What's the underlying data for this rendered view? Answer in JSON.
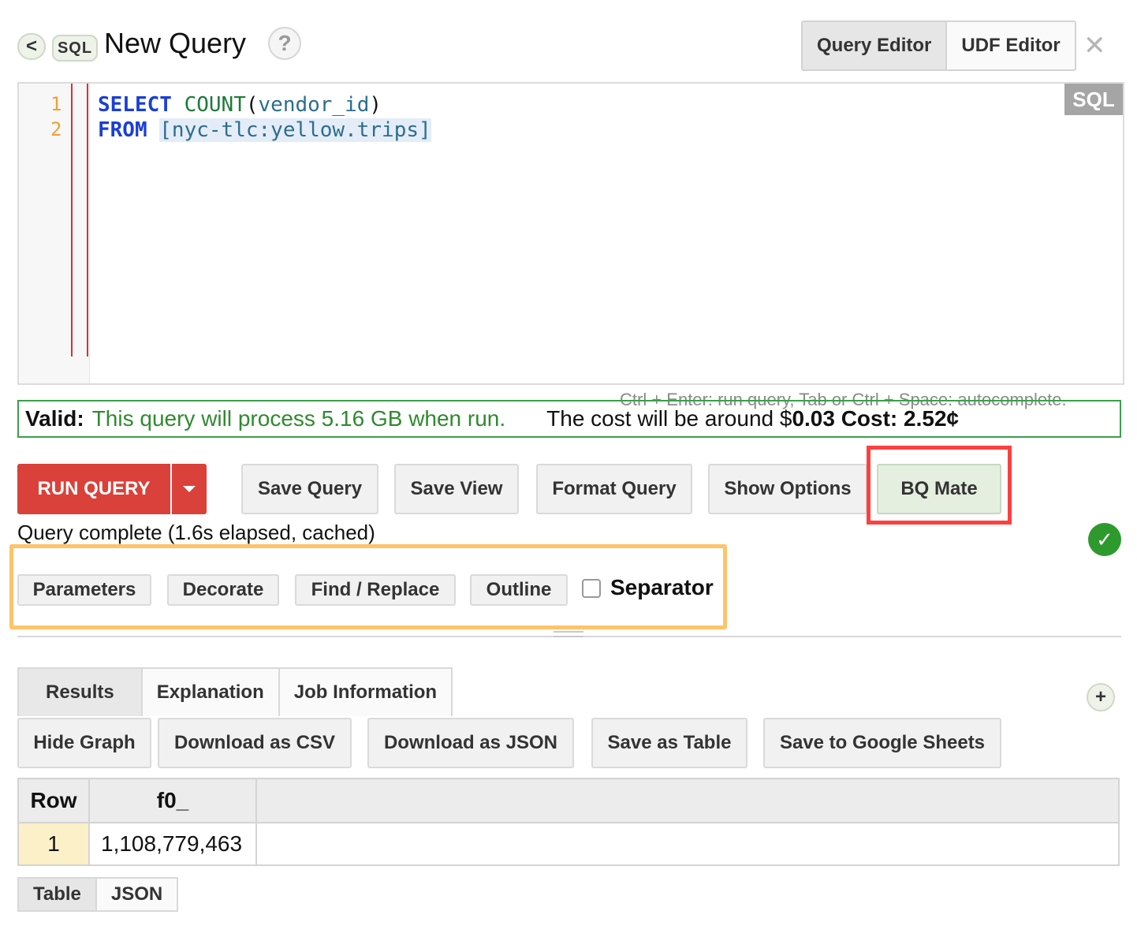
{
  "header": {
    "back_label": "<",
    "sql_badge": "SQL",
    "title": "New Query",
    "help_label": "?",
    "tabs": [
      {
        "label": "Query Editor",
        "active": true
      },
      {
        "label": "UDF Editor",
        "active": false
      }
    ],
    "close_label": "✕"
  },
  "editor": {
    "language_tag": "SQL",
    "line_numbers": [
      "1",
      "2"
    ],
    "lines": [
      {
        "keyword": "SELECT",
        "function": "COUNT",
        "open": "(",
        "arg": "vendor_id",
        "close": ")"
      },
      {
        "keyword": "FROM",
        "table": "[nyc-tlc:yellow.trips]"
      }
    ],
    "hint": "Ctrl + Enter: run query, Tab or Ctrl + Space: autocomplete."
  },
  "validation": {
    "label": "Valid:",
    "message": "This query will process 5.16 GB when run.",
    "cost_prefix": "The cost will be around $",
    "cost_value": "0.03 Cost: 2.52¢"
  },
  "actions": {
    "run_label": "RUN QUERY",
    "buttons": [
      "Save Query",
      "Save View",
      "Format Query",
      "Show Options",
      "BQ Mate"
    ]
  },
  "status": {
    "text": "Query complete (1.6s elapsed, cached)",
    "check": "✓"
  },
  "tools": {
    "buttons": [
      "Parameters",
      "Decorate",
      "Find / Replace",
      "Outline"
    ],
    "separator_label": "Separator"
  },
  "results": {
    "tabs": [
      {
        "label": "Results",
        "active": true
      },
      {
        "label": "Explanation",
        "active": false
      },
      {
        "label": "Job Information",
        "active": false
      }
    ],
    "plus_label": "+",
    "output_buttons": [
      "Hide Graph",
      "Download as CSV",
      "Download as JSON",
      "Save as Table",
      "Save to Google Sheets"
    ],
    "columns": [
      "Row",
      "f0_"
    ],
    "rows": [
      [
        "1",
        "1,108,779,463"
      ]
    ],
    "view_tabs": [
      {
        "label": "Table",
        "active": true
      },
      {
        "label": "JSON",
        "active": false
      }
    ]
  },
  "colors": {
    "run_button": "#d9413a",
    "valid_border": "#3aa04a",
    "valid_text": "#2f8a2f",
    "bqmate_highlight": "#ff4040",
    "tools_highlight": "#ffc36a",
    "ok_check": "#2e9a2e"
  }
}
